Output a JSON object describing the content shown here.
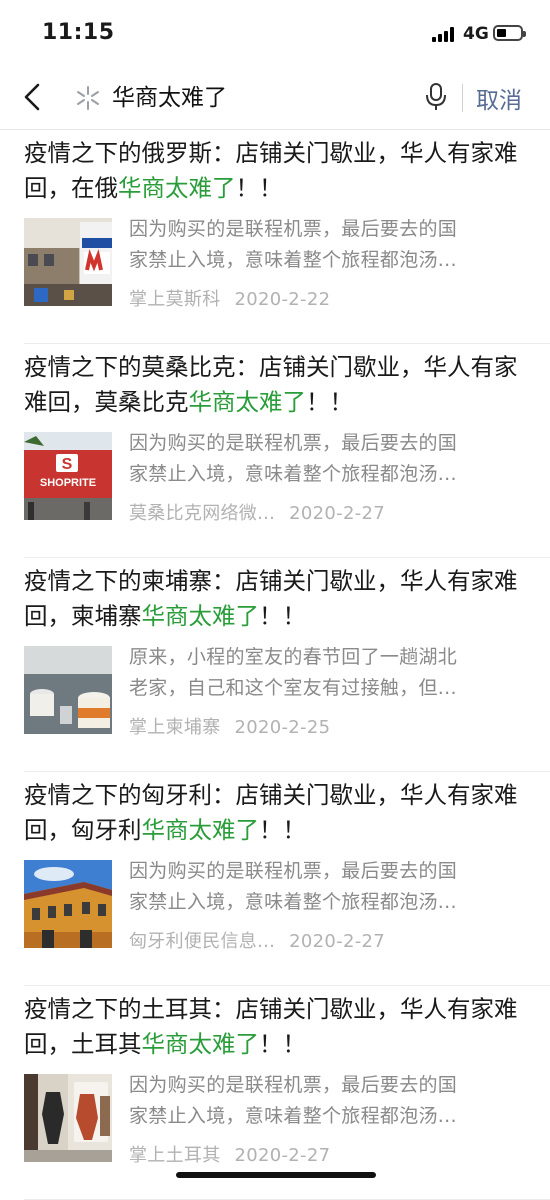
{
  "status_bar": {
    "time": "11:15",
    "network": "4G",
    "icons": [
      "signal-icon",
      "battery-icon"
    ]
  },
  "search": {
    "query": "华商太难了",
    "cancel_label": "取消",
    "icons": [
      "back-icon",
      "spark-icon",
      "mic-icon"
    ]
  },
  "colors": {
    "highlight": "#2a9d3a",
    "cancel": "#576b95",
    "description": "#8a8a8a",
    "meta": "#b2b2b2"
  },
  "results": [
    {
      "title_pre": "疫情之下的俄罗斯：店铺关门歇业，华人有家难回，在俄",
      "title_hl": "华商太难了",
      "title_post": "！！",
      "desc_line1": "因为购买的是联程机票，最后要去的国",
      "desc_line2": "家禁止入境，意味着整个旅程都泡汤...",
      "source": "掌上莫斯科",
      "date": "2020-2-22",
      "thumb": "moscow-street"
    },
    {
      "title_pre": "疫情之下的莫桑比克：店铺关门歇业，华人有家难回，莫桑比克",
      "title_hl": "华商太难了",
      "title_post": "！！",
      "desc_line1": "因为购买的是联程机票，最后要去的国",
      "desc_line2": "家禁止入境，意味着整个旅程都泡汤...",
      "source": "莫桑比克网络微...",
      "date": "2020-2-27",
      "thumb": "shoprite-store",
      "thumb_text": "SHOPRITE"
    },
    {
      "title_pre": "疫情之下的柬埔寨：店铺关门歇业，华人有家难回，柬埔寨",
      "title_hl": "华商太难了",
      "title_post": "！！",
      "desc_line1": "原来，小程的室友的春节回了一趟湖北",
      "desc_line2": "老家，自己和这个室友有过接触，但...",
      "source": "掌上柬埔寨",
      "date": "2020-2-25",
      "thumb": "paint-buckets"
    },
    {
      "title_pre": "疫情之下的匈牙利：店铺关门歇业，华人有家难回，匈牙利",
      "title_hl": "华商太难了",
      "title_post": "！！",
      "desc_line1": "因为购买的是联程机票，最后要去的国",
      "desc_line2": "家禁止入境，意味着整个旅程都泡汤...",
      "source": "匈牙利便民信息...",
      "date": "2020-2-27",
      "thumb": "hungary-building"
    },
    {
      "title_pre": "疫情之下的土耳其：店铺关门歇业，华人有家难回，土耳其",
      "title_hl": "华商太难了",
      "title_post": "！！",
      "desc_line1": "因为购买的是联程机票，最后要去的国",
      "desc_line2": "家禁止入境，意味着整个旅程都泡汤...",
      "source": "掌上土耳其",
      "date": "2020-2-27",
      "thumb": "shop-interior"
    }
  ]
}
